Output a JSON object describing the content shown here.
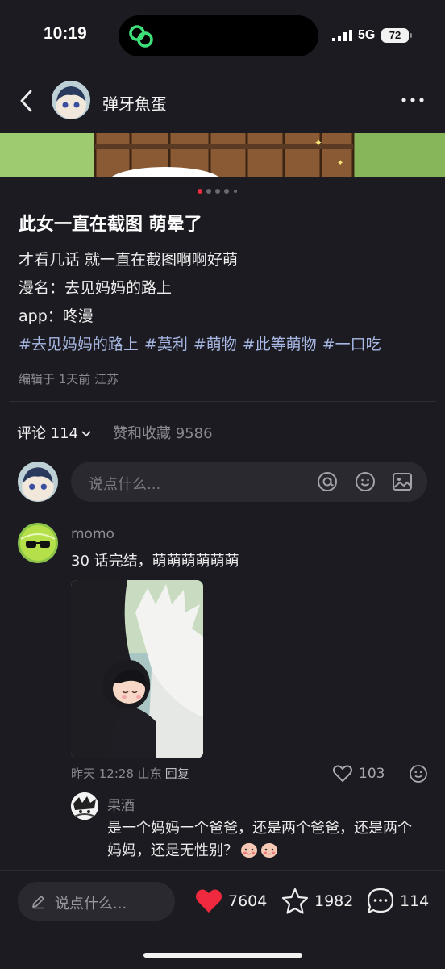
{
  "status_bar": {
    "time": "10:19",
    "network": "5G",
    "battery": "72"
  },
  "header": {
    "author": "弹牙魚蛋"
  },
  "note": {
    "title": "此女一直在截图 萌晕了",
    "body": [
      "才看几话 就一直在截图啊啊好萌",
      "漫名：去见妈妈的路上",
      "app：咚漫"
    ],
    "tags": [
      "#去见妈妈的路上",
      "#莫利",
      "#萌物",
      "#此等萌物",
      "#一口吃"
    ],
    "meta": "编辑于 1天前 江苏",
    "carousel": {
      "count": 5,
      "active": 0
    }
  },
  "comments_header": {
    "comments_label": "评论 114",
    "likes_label": "赞和收藏 9586"
  },
  "comment_input": {
    "placeholder": "说点什么..."
  },
  "comments": [
    {
      "user": "momo",
      "text": "30 话完结，萌萌萌萌萌萌",
      "time_location": "昨天 12:28 山东",
      "reply_label": "回复",
      "likes": "103",
      "replies": [
        {
          "user": "果酒",
          "text": "是一个妈妈一个爸爸，还是两个爸爸，还是两个妈妈，还是无性别？"
        }
      ]
    }
  ],
  "bottom_bar": {
    "placeholder": "说点什么...",
    "likes": "7604",
    "collects": "1982",
    "comments": "114"
  },
  "colors": {
    "background": "#1c1b21",
    "tag": "#a8b9e6",
    "like_red": "#f0293e",
    "carousel_active": "#f0293e"
  }
}
